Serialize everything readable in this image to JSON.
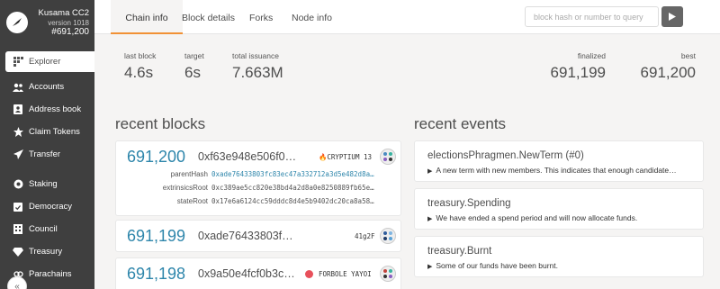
{
  "sidebar": {
    "chain_name": "Kusama CC2",
    "version": "version 1018",
    "block": "#691,200",
    "items": [
      {
        "label": "Explorer",
        "icon": "explorer-icon"
      },
      {
        "label": "Accounts",
        "icon": "users-icon"
      },
      {
        "label": "Address book",
        "icon": "address-book-icon"
      },
      {
        "label": "Claim Tokens",
        "icon": "star-icon"
      },
      {
        "label": "Transfer",
        "icon": "paper-plane-icon"
      },
      {
        "label": "Staking",
        "icon": "certificate-icon"
      },
      {
        "label": "Democracy",
        "icon": "calendar-check-icon"
      },
      {
        "label": "Council",
        "icon": "building-icon"
      },
      {
        "label": "Treasury",
        "icon": "gem-icon"
      },
      {
        "label": "Parachains",
        "icon": "link-icon"
      }
    ]
  },
  "tabs": [
    "Chain info",
    "Block details",
    "Forks",
    "Node info"
  ],
  "search": {
    "placeholder": "block hash or number to query"
  },
  "summary": {
    "last_block": {
      "label": "last block",
      "value": "4.6s"
    },
    "target": {
      "label": "target",
      "value": "6s"
    },
    "total_issuance": {
      "label": "total issuance",
      "value": "7.663M"
    },
    "finalized": {
      "label": "finalized",
      "value": "691,199"
    },
    "best": {
      "label": "best",
      "value": "691,200"
    }
  },
  "recent_blocks": {
    "title": "recent blocks",
    "blocks": [
      {
        "number": "691,200",
        "hash": "0xf63e948e506f0…",
        "author": "CRYPTIUM 13",
        "author_emoji": "🔥",
        "details": [
          {
            "key": "parentHash",
            "value": "0xade76433803fc83ec47a332712a3d5e482d8a…"
          },
          {
            "key": "extrinsicsRoot",
            "value": "0xc389ae5cc820e38bd4a2d8a0e8250889fb65e…"
          },
          {
            "key": "stateRoot",
            "value": "0x17e6a6124cc59dddc8d4e5b9402dc20ca8a58…"
          }
        ]
      },
      {
        "number": "691,199",
        "hash": "0xade76433803f…",
        "author": "41g2F"
      },
      {
        "number": "691,198",
        "hash": "0x9a50e4fcf0b3c…",
        "author": "FORBOLE YAYOI",
        "author_dot_color": "#e8505b"
      }
    ]
  },
  "recent_events": {
    "title": "recent events",
    "events": [
      {
        "title": "electionsPhragmen.NewTerm (#0)",
        "desc": "A new term with new members. This indicates that enough candidate…"
      },
      {
        "title": "treasury.Spending",
        "desc": "We have ended a spend period and will now allocate funds."
      },
      {
        "title": "treasury.Burnt",
        "desc": "Some of our funds have been burnt."
      }
    ]
  },
  "colors": {
    "accent": "#f19135",
    "link": "#2e86ab",
    "sidebar_bg": "#3f3f3f"
  }
}
